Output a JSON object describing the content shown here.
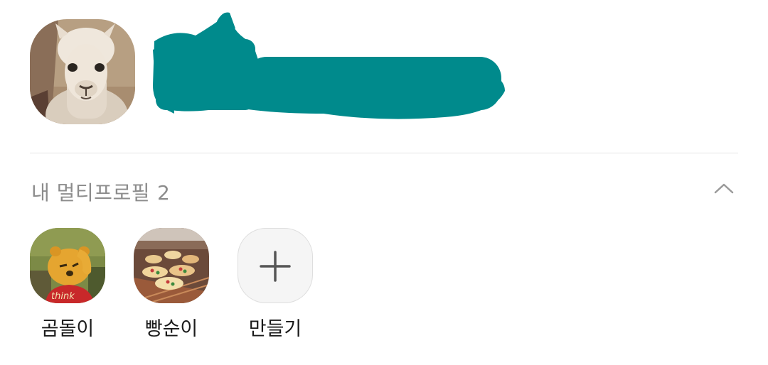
{
  "profile": {
    "avatar_icon": "alpaca-photo",
    "name_redaction_color": "#008a8c"
  },
  "multi_profile": {
    "title": "내 멀티프로필",
    "count": "2",
    "collapse_icon": "chevron-up-icon",
    "items": [
      {
        "label": "곰돌이",
        "avatar_icon": "pooh-bear-photo"
      },
      {
        "label": "빵순이",
        "avatar_icon": "bakery-photo"
      }
    ],
    "create": {
      "label": "만들기",
      "icon": "plus-icon"
    }
  }
}
